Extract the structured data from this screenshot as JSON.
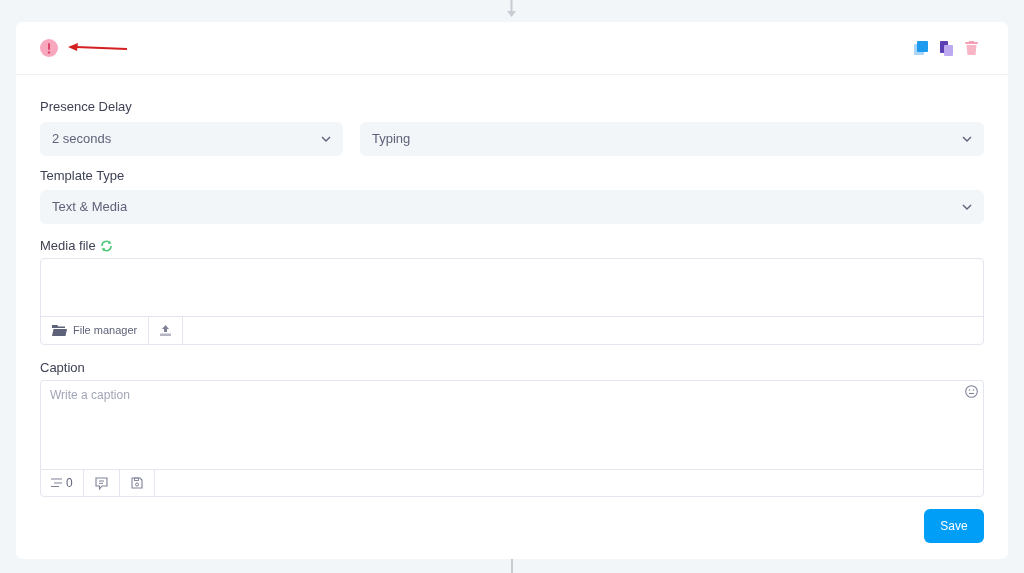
{
  "presence_delay": {
    "label": "Presence Delay",
    "duration": "2 seconds",
    "presence": "Typing"
  },
  "template_type": {
    "label": "Template Type",
    "value": "Text & Media"
  },
  "media_file": {
    "label": "Media file",
    "file_manager": "File manager"
  },
  "caption": {
    "label": "Caption",
    "placeholder": "Write a caption",
    "counter": "0"
  },
  "save_button": "Save"
}
